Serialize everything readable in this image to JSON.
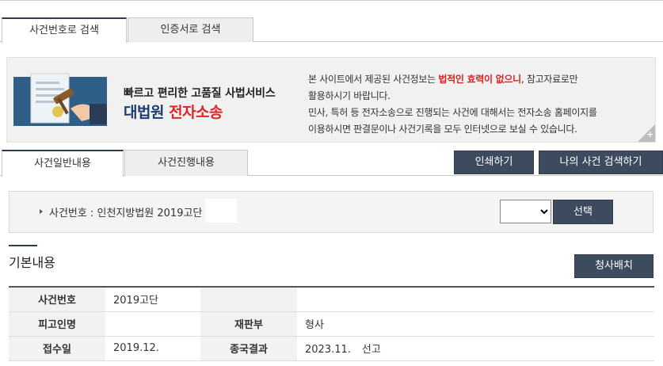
{
  "search_tabs": [
    {
      "label": "사건번호로 검색",
      "active": true
    },
    {
      "label": "인증서로 검색",
      "active": false
    }
  ],
  "banner": {
    "title_line1": "빠르고 편리한 고품질 사법서비스",
    "title_brand": "대법원",
    "title_red": "전자소송",
    "notice_prefix": "본 사이트에서 제공된 사건정보는 ",
    "notice_highlight": "법적인 효력이 없으니",
    "notice_suffix": ", 참고자료로만",
    "notice_line2": "활용하시기 바랍니다.",
    "notice_line3": "민사, 특허 등 전자소송으로 진행되는 사건에 대해서는 전자소송 홈페이지를",
    "notice_line4": "이용하시면 판결문이나 사건기록을 모두 인터넷으로 보실 수 있습니다.",
    "plus_label": "+"
  },
  "content_tabs": [
    {
      "label": "사건일반내용",
      "active": true
    },
    {
      "label": "사건진행내용",
      "active": false
    }
  ],
  "actions": {
    "print_label": "인쇄하기",
    "my_case_search_label": "나의 사건 검색하기"
  },
  "case_selector": {
    "label": "사건번호 : 인천지방법원 2019고단",
    "select_value": "",
    "select_button_label": "선택"
  },
  "section": {
    "title": "기본내용",
    "court_seating_label": "청사배치"
  },
  "basic_info": [
    {
      "label1": "사건번호",
      "value1": "2019고단",
      "label2": "",
      "value2": ""
    },
    {
      "label1": "피고인명",
      "value1": "",
      "label2": "재판부",
      "value2": "형사"
    },
    {
      "label1": "접수일",
      "value1": "2019.12.",
      "label2": "종국결과",
      "value2": "2023.11.",
      "value2_suffix": "선고"
    }
  ],
  "colors": {
    "dark_button": "#3c4b5e",
    "brand_blue": "#1c3a73",
    "brand_red": "#d8282a",
    "notice_red": "#e0201f"
  }
}
